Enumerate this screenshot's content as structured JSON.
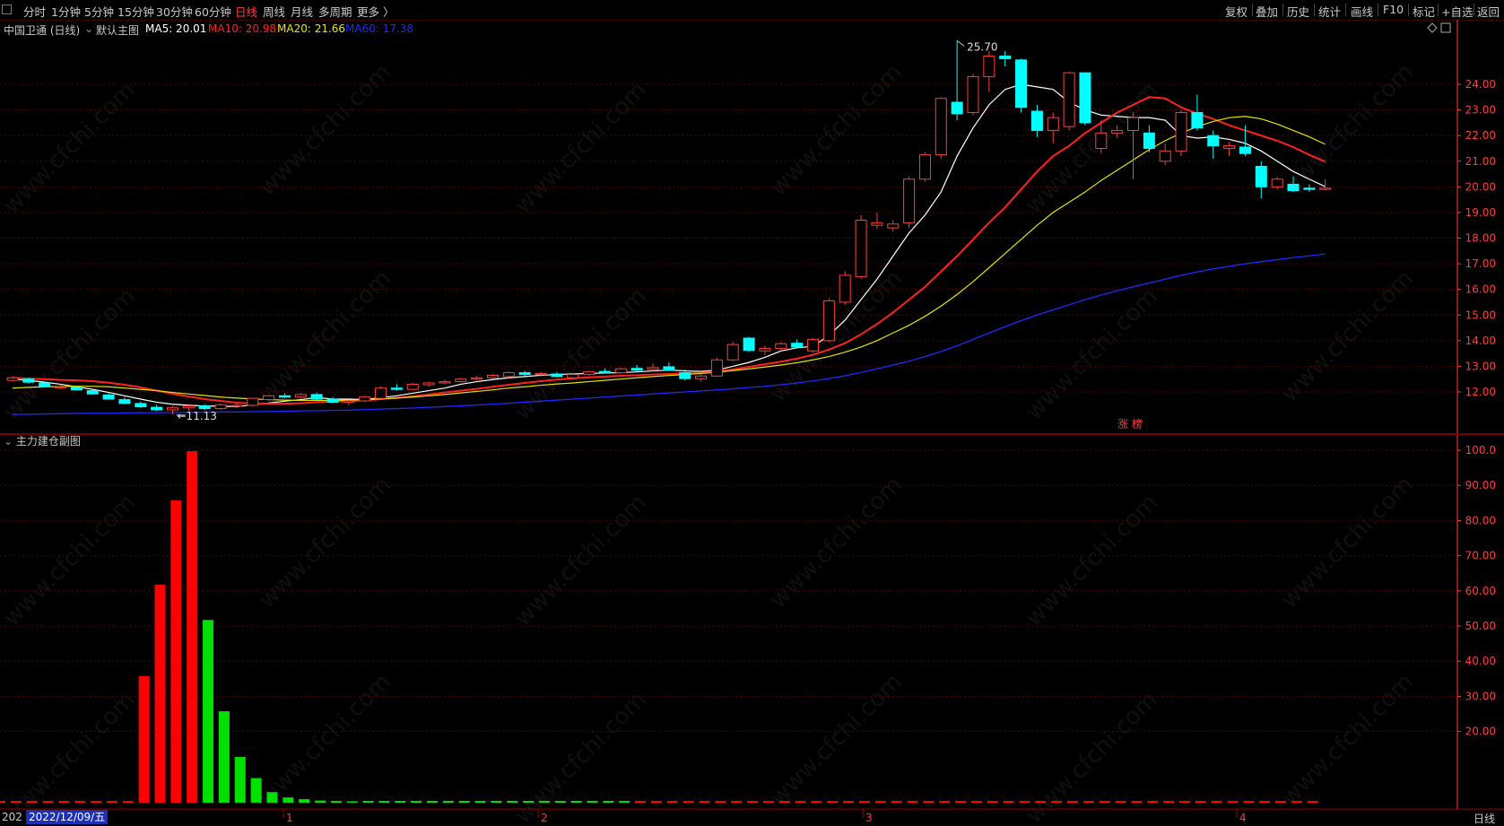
{
  "toolbar": {
    "periods": [
      "分时",
      "1分钟",
      "5分钟",
      "15分钟",
      "30分钟",
      "60分钟",
      "日线",
      "周线",
      "月线",
      "多周期",
      "更多 〉"
    ],
    "active_period": "日线",
    "right_buttons": [
      "复权",
      "叠加",
      "历史",
      "统计",
      "画线",
      "F10",
      "标记",
      "+自选",
      "返回"
    ]
  },
  "info_bar": {
    "stock": "中国卫通 (日线)",
    "main_chart": "默认主图",
    "ma5": "MA5: 20.01",
    "ma10": "MA10: 20.98",
    "ma20": "MA20: 21.66",
    "ma60": "MA60: 17.38"
  },
  "colors": {
    "up": "#ff3c3c",
    "down": "#00ffff",
    "ma5": "#ffffff",
    "ma10": "#ff2020",
    "ma20": "#e5e500",
    "ma60": "#1e28ff",
    "grid": "#5a0000",
    "axis": "#ff3c3c",
    "vol_up": "#ff0000",
    "vol_down": "#00e000"
  },
  "price_axis": {
    "ticks": [
      "24.00",
      "23.00",
      "22.00",
      "21.00",
      "20.00",
      "19.00",
      "18.00",
      "17.00",
      "16.00",
      "15.00",
      "14.00",
      "13.00",
      "12.00"
    ]
  },
  "annotations": {
    "high": "25.70",
    "low": "11.13",
    "tag": "涨 榜"
  },
  "indicator": {
    "title": "主力建仓副图",
    "ticks": [
      "100.0",
      "90.00",
      "80.00",
      "70.00",
      "60.00",
      "50.00",
      "40.00",
      "30.00",
      "20.00"
    ]
  },
  "time_axis": {
    "month_labels": [
      "1",
      "2",
      "3",
      "4"
    ],
    "date_prefix": "202",
    "cursor_date": "2022/12/09/五",
    "period_label": "日线"
  },
  "watermark": "www.cfchi.com",
  "chart_data": {
    "type": "candlestick",
    "series_ohlc_comment": "per-candle [open, high, low, close], oldest first",
    "candles": [
      [
        12.45,
        12.62,
        12.42,
        12.55
      ],
      [
        12.5,
        12.55,
        12.32,
        12.38
      ],
      [
        12.35,
        12.4,
        12.18,
        12.22
      ],
      [
        12.2,
        12.28,
        12.12,
        12.2
      ],
      [
        12.18,
        12.22,
        12.05,
        12.08
      ],
      [
        12.05,
        12.1,
        11.9,
        11.92
      ],
      [
        11.88,
        11.95,
        11.7,
        11.72
      ],
      [
        11.7,
        11.8,
        11.52,
        11.55
      ],
      [
        11.55,
        11.62,
        11.38,
        11.42
      ],
      [
        11.4,
        11.5,
        11.25,
        11.3
      ],
      [
        11.3,
        11.45,
        11.13,
        11.38
      ],
      [
        11.38,
        11.5,
        11.28,
        11.45
      ],
      [
        11.45,
        11.52,
        11.3,
        11.35
      ],
      [
        11.35,
        11.55,
        11.3,
        11.5
      ],
      [
        11.45,
        11.58,
        11.38,
        11.48
      ],
      [
        11.48,
        11.78,
        11.42,
        11.75
      ],
      [
        11.7,
        11.88,
        11.65,
        11.85
      ],
      [
        11.85,
        11.95,
        11.75,
        11.8
      ],
      [
        11.8,
        11.95,
        11.74,
        11.9
      ],
      [
        11.9,
        11.98,
        11.68,
        11.72
      ],
      [
        11.72,
        11.8,
        11.55,
        11.6
      ],
      [
        11.6,
        11.7,
        11.48,
        11.65
      ],
      [
        11.65,
        11.85,
        11.6,
        11.8
      ],
      [
        11.75,
        12.22,
        11.72,
        12.15
      ],
      [
        12.15,
        12.3,
        12.05,
        12.1
      ],
      [
        12.1,
        12.35,
        12.08,
        12.3
      ],
      [
        12.28,
        12.4,
        12.2,
        12.35
      ],
      [
        12.35,
        12.48,
        12.3,
        12.4
      ],
      [
        12.4,
        12.55,
        12.36,
        12.5
      ],
      [
        12.5,
        12.62,
        12.45,
        12.55
      ],
      [
        12.55,
        12.7,
        12.5,
        12.65
      ],
      [
        12.6,
        12.8,
        12.55,
        12.75
      ],
      [
        12.75,
        12.82,
        12.62,
        12.68
      ],
      [
        12.68,
        12.78,
        12.6,
        12.72
      ],
      [
        12.7,
        12.78,
        12.58,
        12.6
      ],
      [
        12.55,
        12.72,
        12.5,
        12.68
      ],
      [
        12.68,
        12.82,
        12.64,
        12.78
      ],
      [
        12.8,
        12.92,
        12.72,
        12.75
      ],
      [
        12.75,
        12.95,
        12.72,
        12.9
      ],
      [
        12.92,
        13.05,
        12.8,
        12.85
      ],
      [
        12.88,
        13.12,
        12.82,
        12.95
      ],
      [
        12.98,
        13.15,
        12.9,
        12.85
      ],
      [
        12.75,
        12.88,
        12.45,
        12.52
      ],
      [
        12.52,
        12.68,
        12.4,
        12.62
      ],
      [
        12.62,
        13.35,
        12.6,
        13.25
      ],
      [
        13.25,
        13.95,
        13.2,
        13.85
      ],
      [
        14.1,
        14.15,
        13.55,
        13.62
      ],
      [
        13.6,
        13.8,
        13.45,
        13.7
      ],
      [
        13.7,
        13.95,
        13.6,
        13.88
      ],
      [
        13.9,
        14.05,
        13.7,
        13.75
      ],
      [
        13.6,
        14.1,
        13.55,
        14.05
      ],
      [
        14.0,
        15.65,
        13.95,
        15.55
      ],
      [
        15.5,
        16.7,
        15.4,
        16.55
      ],
      [
        16.5,
        18.9,
        16.4,
        18.7
      ],
      [
        18.5,
        19.0,
        18.35,
        18.6
      ],
      [
        18.4,
        18.7,
        18.25,
        18.55
      ],
      [
        18.6,
        20.4,
        18.4,
        20.3
      ],
      [
        20.3,
        21.35,
        20.2,
        21.25
      ],
      [
        21.25,
        23.5,
        21.1,
        23.45
      ],
      [
        23.3,
        25.7,
        22.6,
        22.85
      ],
      [
        22.9,
        24.4,
        22.8,
        24.3
      ],
      [
        24.3,
        25.3,
        23.7,
        25.1
      ],
      [
        25.1,
        25.3,
        24.7,
        25.0
      ],
      [
        24.95,
        25.0,
        22.9,
        23.1
      ],
      [
        22.95,
        23.2,
        21.95,
        22.2
      ],
      [
        22.2,
        22.9,
        21.7,
        22.7
      ],
      [
        22.35,
        24.5,
        22.2,
        24.45
      ],
      [
        24.45,
        24.45,
        22.4,
        22.5
      ],
      [
        21.5,
        22.6,
        21.3,
        22.1
      ],
      [
        22.1,
        22.4,
        21.9,
        22.2
      ],
      [
        22.2,
        22.9,
        20.3,
        22.7
      ],
      [
        22.1,
        22.4,
        21.35,
        21.5
      ],
      [
        21.0,
        21.7,
        20.85,
        21.4
      ],
      [
        21.4,
        23.0,
        21.2,
        22.9
      ],
      [
        22.9,
        23.6,
        22.2,
        22.3
      ],
      [
        22.0,
        22.2,
        21.1,
        21.6
      ],
      [
        21.5,
        21.75,
        21.2,
        21.6
      ],
      [
        21.55,
        22.4,
        21.2,
        21.3
      ],
      [
        20.8,
        21.0,
        19.55,
        20.0
      ],
      [
        20.0,
        20.4,
        19.9,
        20.3
      ],
      [
        20.1,
        20.4,
        19.8,
        19.85
      ],
      [
        19.95,
        20.1,
        19.8,
        19.9
      ],
      [
        19.9,
        20.3,
        19.85,
        19.95
      ]
    ],
    "ma": {
      "MA5": [
        12.5,
        12.45,
        12.38,
        12.3,
        12.2,
        12.1,
        11.98,
        11.85,
        11.72,
        11.6,
        11.52,
        11.48,
        11.45,
        11.45,
        11.42,
        11.5,
        11.57,
        11.64,
        11.7,
        11.78,
        11.72,
        11.72,
        11.7,
        11.78,
        11.85,
        11.95,
        12.05,
        12.15,
        12.3,
        12.4,
        12.48,
        12.55,
        12.6,
        12.65,
        12.68,
        12.7,
        12.72,
        12.74,
        12.75,
        12.78,
        12.82,
        12.85,
        12.82,
        12.8,
        12.85,
        13.0,
        13.15,
        13.35,
        13.6,
        13.72,
        13.78,
        14.2,
        14.8,
        15.6,
        16.4,
        17.3,
        18.2,
        18.9,
        19.8,
        21.2,
        22.3,
        23.2,
        23.8,
        24.0,
        23.9,
        23.8,
        23.3,
        23.0,
        22.8,
        22.75,
        22.7,
        22.7,
        22.6,
        22.0,
        21.9,
        21.95,
        21.85,
        21.7,
        21.4,
        21.0,
        20.6,
        20.3,
        20.01
      ],
      "MA10": [
        12.55,
        12.52,
        12.5,
        12.47,
        12.45,
        12.42,
        12.36,
        12.28,
        12.18,
        12.05,
        11.93,
        11.82,
        11.72,
        11.65,
        11.58,
        11.55,
        11.54,
        11.54,
        11.56,
        11.6,
        11.62,
        11.64,
        11.67,
        11.72,
        11.77,
        11.83,
        11.9,
        11.98,
        12.05,
        12.12,
        12.2,
        12.28,
        12.35,
        12.42,
        12.48,
        12.53,
        12.57,
        12.6,
        12.63,
        12.65,
        12.68,
        12.7,
        12.72,
        12.75,
        12.8,
        12.88,
        12.98,
        13.08,
        13.18,
        13.3,
        13.45,
        13.65,
        13.9,
        14.25,
        14.65,
        15.1,
        15.6,
        16.1,
        16.7,
        17.3,
        17.95,
        18.6,
        19.2,
        19.9,
        20.6,
        21.2,
        21.6,
        22.1,
        22.5,
        22.9,
        23.2,
        23.5,
        23.45,
        23.1,
        22.85,
        22.65,
        22.4,
        22.2,
        22.0,
        21.8,
        21.55,
        21.25,
        20.98
      ],
      "MA20": [
        12.15,
        12.18,
        12.2,
        12.21,
        12.22,
        12.22,
        12.2,
        12.15,
        12.1,
        12.05,
        11.98,
        11.92,
        11.86,
        11.8,
        11.76,
        11.73,
        11.7,
        11.68,
        11.67,
        11.67,
        11.67,
        11.68,
        11.7,
        11.73,
        11.76,
        11.8,
        11.85,
        11.9,
        11.96,
        12.02,
        12.08,
        12.15,
        12.2,
        12.26,
        12.31,
        12.35,
        12.4,
        12.45,
        12.5,
        12.55,
        12.6,
        12.64,
        12.68,
        12.72,
        12.77,
        12.83,
        12.9,
        12.97,
        13.05,
        13.14,
        13.25,
        13.38,
        13.55,
        13.75,
        14.0,
        14.3,
        14.6,
        14.95,
        15.35,
        15.8,
        16.3,
        16.85,
        17.4,
        17.95,
        18.5,
        19.0,
        19.4,
        19.8,
        20.25,
        20.65,
        21.05,
        21.45,
        21.8,
        22.1,
        22.35,
        22.55,
        22.7,
        22.75,
        22.65,
        22.45,
        22.2,
        21.95,
        21.66
      ],
      "MA60": [
        11.12,
        11.13,
        11.14,
        11.15,
        11.16,
        11.17,
        11.17,
        11.18,
        11.19,
        11.19,
        11.2,
        11.2,
        11.21,
        11.22,
        11.22,
        11.23,
        11.24,
        11.25,
        11.26,
        11.27,
        11.28,
        11.29,
        11.31,
        11.33,
        11.35,
        11.37,
        11.4,
        11.43,
        11.46,
        11.49,
        11.52,
        11.56,
        11.6,
        11.64,
        11.68,
        11.72,
        11.76,
        11.8,
        11.84,
        11.88,
        11.92,
        11.96,
        12.0,
        12.04,
        12.08,
        12.12,
        12.17,
        12.22,
        12.28,
        12.35,
        12.43,
        12.52,
        12.63,
        12.76,
        12.9,
        13.05,
        13.2,
        13.38,
        13.58,
        13.8,
        14.05,
        14.3,
        14.55,
        14.78,
        15.0,
        15.2,
        15.4,
        15.6,
        15.78,
        15.95,
        16.1,
        16.25,
        16.4,
        16.55,
        16.68,
        16.8,
        16.9,
        17.0,
        17.08,
        17.16,
        17.24,
        17.31,
        17.38
      ]
    },
    "indicator_bars": [
      0,
      0,
      0,
      0,
      0,
      0,
      0,
      0,
      0,
      36,
      62,
      86,
      100,
      52,
      26,
      13,
      7,
      3,
      1.5,
      1,
      0.6,
      0.5,
      0.4,
      0.3,
      0.2,
      0.15,
      0.1,
      0.1,
      0.1,
      0.05,
      0.05,
      0.05,
      0.05,
      0.05,
      0.05,
      0.05,
      0.05,
      0.05,
      0.05,
      0.05,
      0,
      0,
      0,
      0,
      0,
      0,
      0,
      0,
      0,
      0,
      0,
      0,
      0,
      0,
      0,
      0,
      0,
      0,
      0,
      0,
      0,
      0,
      0,
      0,
      0,
      0,
      0,
      0,
      0,
      0,
      0,
      0,
      0,
      0,
      0,
      0,
      0,
      0,
      0,
      0,
      0,
      0,
      0
    ],
    "indicator_bar_colors": [
      "r",
      "r",
      "r",
      "r",
      "r",
      "r",
      "r",
      "r",
      "r",
      "r",
      "r",
      "r",
      "r",
      "g",
      "g",
      "g",
      "g",
      "g",
      "g",
      "g",
      "g",
      "g",
      "g",
      "g",
      "g",
      "g",
      "g",
      "g",
      "g",
      "g",
      "g",
      "g",
      "g",
      "g",
      "g",
      "g",
      "g",
      "g",
      "g",
      "g",
      "r",
      "r",
      "r",
      "r",
      "r",
      "r",
      "r",
      "r",
      "r",
      "r",
      "r",
      "r",
      "r",
      "r",
      "r",
      "r",
      "r",
      "r",
      "r",
      "r",
      "r",
      "r",
      "r",
      "r",
      "r",
      "r",
      "r",
      "r",
      "r",
      "r",
      "r",
      "r",
      "r",
      "r",
      "r",
      "r",
      "r",
      "r",
      "r",
      "r",
      "r",
      "r",
      "r"
    ],
    "price_range": [
      11.0,
      25.5
    ],
    "indicator_range": [
      0,
      100
    ],
    "grid": true
  }
}
